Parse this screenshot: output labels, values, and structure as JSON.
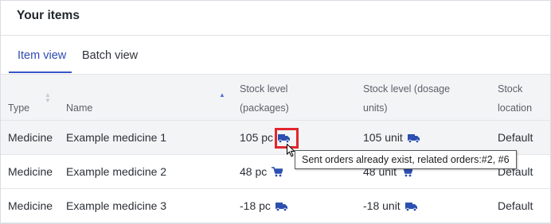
{
  "card": {
    "title": "Your items"
  },
  "tabs": [
    {
      "label": "Item view",
      "active": true
    },
    {
      "label": "Batch view",
      "active": false
    }
  ],
  "table": {
    "columns": {
      "type": "Type",
      "name": "Name",
      "stock_packages": [
        "Stock level",
        "(packages)"
      ],
      "stock_units": [
        "Stock level (dosage",
        "units)"
      ],
      "location": [
        "Stock",
        "location"
      ]
    },
    "rows": [
      {
        "type": "Medicine",
        "name": "Example medicine 1",
        "stock_packages": "105 pc",
        "packages_icon": "truck-icon",
        "stock_units": "105 unit",
        "units_icon": "truck-icon",
        "location": "Default"
      },
      {
        "type": "Medicine",
        "name": "Example medicine 2",
        "stock_packages": "48 pc",
        "packages_icon": "cart-icon",
        "stock_units": "48 unit",
        "units_icon": "cart-icon",
        "location": "Default"
      },
      {
        "type": "Medicine",
        "name": "Example medicine 3",
        "stock_packages": "-18 pc",
        "packages_icon": "truck-icon",
        "stock_units": "-18 unit",
        "units_icon": "truck-icon",
        "location": "Default"
      }
    ]
  },
  "tooltip": {
    "text": "Sent orders already exist, related orders:#2, #6"
  },
  "colors": {
    "accent": "#2f4bb3",
    "icon": "#2c4fb0",
    "highlight": "#e0262b"
  }
}
